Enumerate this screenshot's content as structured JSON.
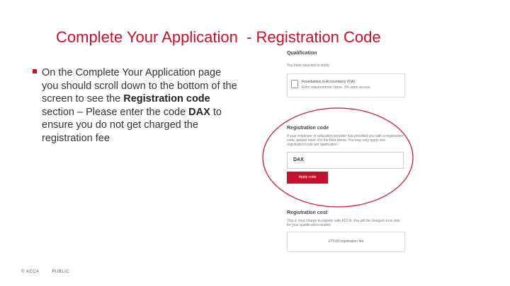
{
  "slide": {
    "title": "Complete Your Application  - Registration Code",
    "bullet": {
      "part1": "On the Complete Your Application page you should scroll down to the bottom of the screen to see the ",
      "bold1": "Registration code",
      "part2": " section – Please enter the code ",
      "bold2": "DAX",
      "part3": " to ensure you do not get charged the registration fee"
    },
    "footer": {
      "copyright": "© ACCA",
      "classification": "PUBLIC"
    }
  },
  "screenshot": {
    "qualification_heading": "Qualification",
    "selected_label": "You have selected to study:",
    "qualification_name": "Foundations in Accountancy (FIA)",
    "qualification_entry": "Entry requirements: None. 3% open access",
    "registration_code_heading": "Registration code",
    "registration_code_help": "If your employer or education provider has provided you with a registration code, please enter it in the field below. You may only apply one registration code per application",
    "code_value": "DAX",
    "apply_button": "Apply code",
    "registration_cost_heading": "Registration cost",
    "registration_cost_help": "This is your charge to register with ACCA. You will be charged once only for your qualification studies",
    "registration_fee": "£79.00 registration fee",
    "highlight_color": "#c8102e"
  }
}
